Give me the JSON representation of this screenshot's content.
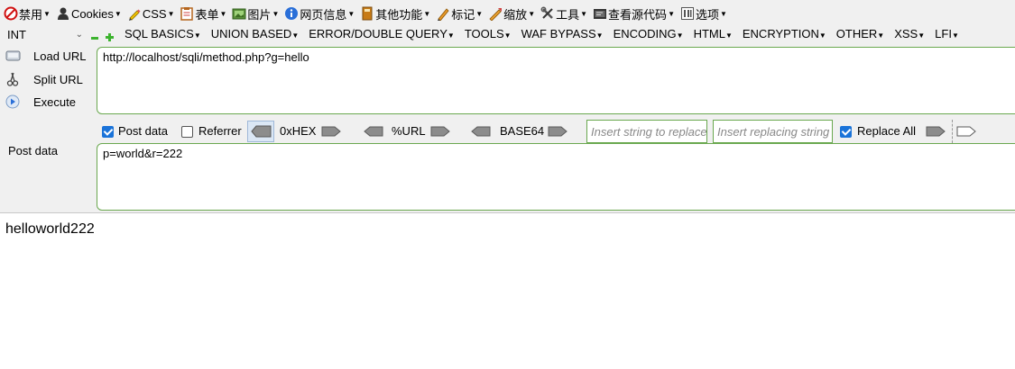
{
  "toolbar": {
    "items": [
      {
        "label": "禁用",
        "icon": "disable-icon"
      },
      {
        "label": "Cookies",
        "icon": "user-icon"
      },
      {
        "label": "CSS",
        "icon": "pencil-icon"
      },
      {
        "label": "表单",
        "icon": "form-icon"
      },
      {
        "label": "图片",
        "icon": "image-icon"
      },
      {
        "label": "网页信息",
        "icon": "info-icon"
      },
      {
        "label": "其他功能",
        "icon": "book-icon"
      },
      {
        "label": "标记",
        "icon": "highlighter-icon"
      },
      {
        "label": "缩放",
        "icon": "resize-icon"
      },
      {
        "label": "工具",
        "icon": "wrench-icon"
      },
      {
        "label": "查看源代码",
        "icon": "source-icon"
      },
      {
        "label": "选项",
        "icon": "options-icon"
      }
    ]
  },
  "hackbar": {
    "level": "INT",
    "menus": [
      "SQL BASICS",
      "UNION BASED",
      "ERROR/DOUBLE QUERY",
      "TOOLS",
      "WAF BYPASS",
      "ENCODING",
      "HTML",
      "ENCRYPTION",
      "OTHER",
      "XSS",
      "LFI"
    ],
    "actions": {
      "load": "Load URL",
      "split": "Split URL",
      "execute": "Execute"
    },
    "url_value": "http://localhost/sqli/method.php?g=hello",
    "options": {
      "post_data_label": "Post data",
      "post_data_checked": true,
      "referrer_label": "Referrer",
      "referrer_checked": false,
      "hex_label": "0xHEX",
      "url_label": "%URL",
      "base64_label": "BASE64",
      "insert_placeholder": "Insert string to replace",
      "replacing_placeholder": "Insert replacing string",
      "replace_all_label": "Replace All",
      "replace_all_checked": true
    },
    "post_label": "Post data",
    "post_value": "p=world&r=222"
  },
  "result": "helloworld222"
}
